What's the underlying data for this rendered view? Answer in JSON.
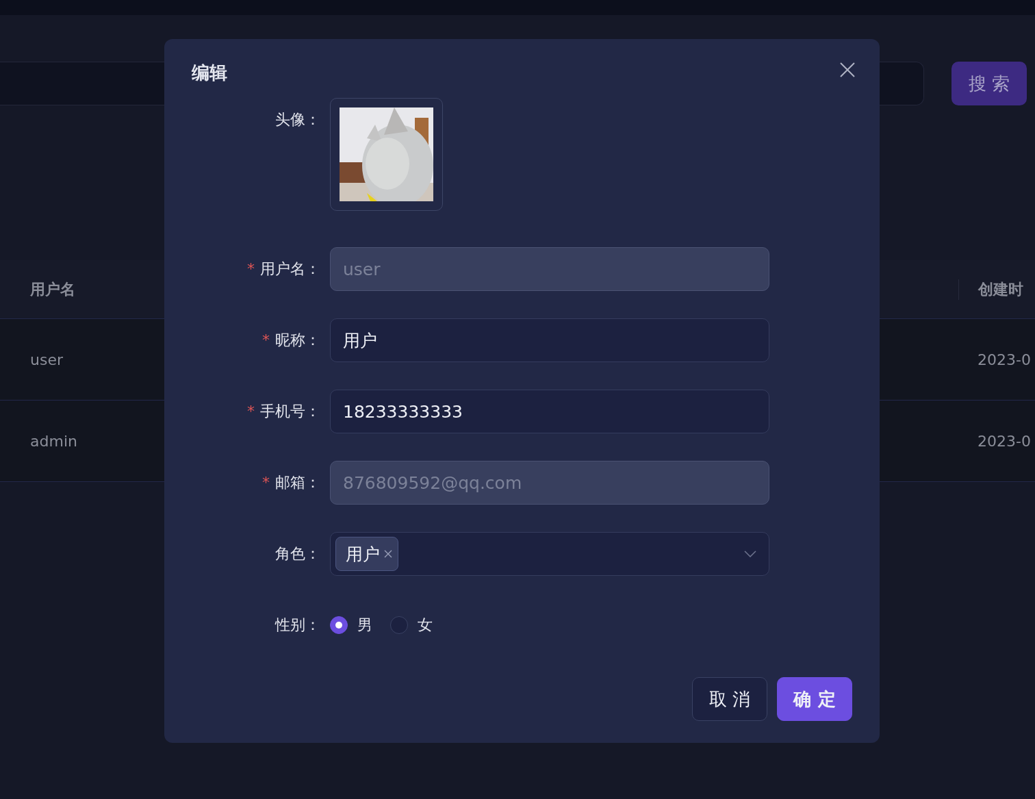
{
  "background": {
    "search_button": "搜 索",
    "table": {
      "columns": [
        "用户名",
        "创建时"
      ],
      "rows": [
        [
          "user",
          "2023-0"
        ],
        [
          "admin",
          "2023-0"
        ]
      ]
    }
  },
  "dialog": {
    "title": "编辑",
    "required_mark": "*",
    "fields": [
      {
        "kind": "avatar",
        "label": "头像：",
        "required": false
      },
      {
        "kind": "text",
        "label": "用户名：",
        "required": true,
        "value": "user",
        "disabled": true
      },
      {
        "kind": "text",
        "label": "昵称：",
        "required": true,
        "value": "用户",
        "disabled": false
      },
      {
        "kind": "text",
        "label": "手机号：",
        "required": true,
        "value": "18233333333",
        "disabled": false
      },
      {
        "kind": "text",
        "label": "邮箱：",
        "required": true,
        "value": "876809592@qq.com",
        "disabled": true
      },
      {
        "kind": "select",
        "label": "角色：",
        "required": false,
        "tags": [
          "用户"
        ]
      },
      {
        "kind": "radio",
        "label": "性别：",
        "required": false,
        "options": [
          {
            "label": "男",
            "selected": true
          },
          {
            "label": "女",
            "selected": false
          }
        ]
      }
    ],
    "buttons": [
      {
        "label": "取 消",
        "kind": "secondary"
      },
      {
        "label": "确 定",
        "kind": "primary"
      }
    ]
  }
}
